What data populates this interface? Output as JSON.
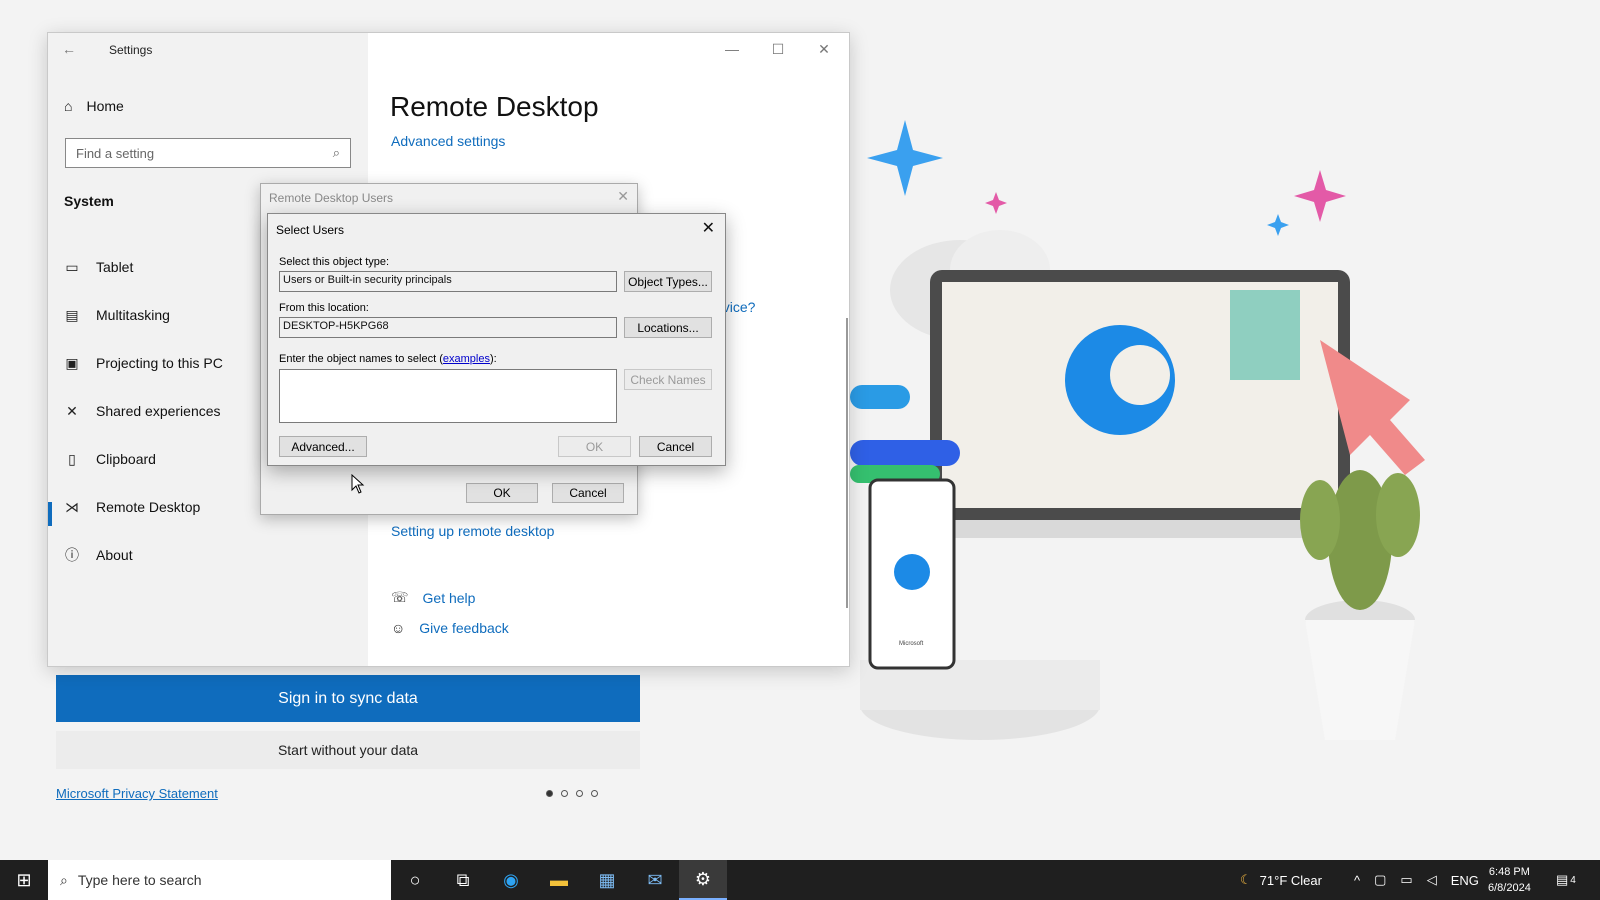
{
  "background": {
    "sync_button": "Sign in to sync data",
    "start_button": "Start without your data",
    "privacy_link": "Microsoft Privacy Statement",
    "pager": {
      "total": 4,
      "active": 1
    },
    "phone_brand": "Microsoft"
  },
  "settings": {
    "title": "Settings",
    "home": "Home",
    "search_placeholder": "Find a setting",
    "section": "System",
    "nav": [
      {
        "label": "Tablet",
        "icon": "tablet-icon"
      },
      {
        "label": "Multitasking",
        "icon": "multitasking-icon"
      },
      {
        "label": "Projecting to this PC",
        "icon": "projecting-icon"
      },
      {
        "label": "Shared experiences",
        "icon": "shared-experiences-icon"
      },
      {
        "label": "Clipboard",
        "icon": "clipboard-icon"
      },
      {
        "label": "Remote Desktop",
        "icon": "remote-desktop-icon",
        "active": true
      },
      {
        "label": "About",
        "icon": "info-icon"
      }
    ],
    "page_title": "Remote Desktop",
    "advanced_link": "Advanced settings",
    "partial_device_link": "evice?",
    "partial_colon": ":",
    "setup_link": "Setting up remote desktop",
    "get_help": "Get help",
    "give_feedback": "Give feedback"
  },
  "rdu_dialog": {
    "title": "Remote Desktop Users",
    "ok": "OK",
    "cancel": "Cancel"
  },
  "select_users": {
    "title": "Select Users",
    "object_type_label": "Select this object type:",
    "object_type_value": "Users or Built-in security principals",
    "object_types_button": "Object Types...",
    "location_label": "From this location:",
    "location_value": "DESKTOP-H5KPG68",
    "locations_button": "Locations...",
    "names_label_prefix": "Enter the object names to select (",
    "names_label_link": "examples",
    "names_label_suffix": "):",
    "names_value": "",
    "check_names_button": "Check Names",
    "advanced_button": "Advanced...",
    "ok": "OK",
    "cancel": "Cancel"
  },
  "taskbar": {
    "search_placeholder": "Type here to search",
    "weather": "71°F  Clear",
    "language": "ENG",
    "time": "6:48 PM",
    "date": "6/8/2024",
    "notification_count": "4"
  }
}
